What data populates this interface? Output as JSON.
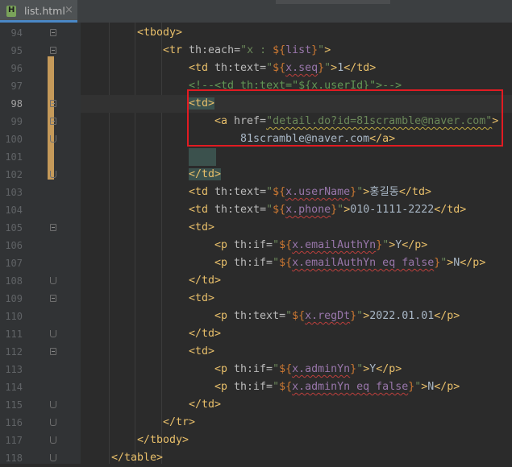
{
  "tab": {
    "file_name": "list.html",
    "close_glyph": "×",
    "file_icon": "html-file-icon"
  },
  "gutter": {
    "line_numbers": [
      "94",
      "95",
      "96",
      "97",
      "98",
      "99",
      "100",
      "101",
      "102",
      "103",
      "104",
      "105",
      "106",
      "107",
      "108",
      "109",
      "110",
      "111",
      "112",
      "113",
      "114",
      "115",
      "116",
      "117",
      "118"
    ],
    "current_line": "98"
  },
  "lines": [
    {
      "n": "94",
      "tokens": [
        [
          "tag",
          "<tbody>"
        ]
      ]
    },
    {
      "n": "95",
      "tokens": [
        [
          "tag",
          "<tr "
        ],
        [
          "attr",
          "th:each="
        ],
        [
          "str",
          "\"x : "
        ],
        [
          "expr",
          "${"
        ],
        [
          "var",
          "list"
        ],
        [
          "expr",
          "}"
        ],
        [
          "str",
          "\""
        ],
        [
          "tag",
          ">"
        ]
      ]
    },
    {
      "n": "96",
      "tokens": [
        [
          "tag",
          "<td "
        ],
        [
          "attr",
          "th:text="
        ],
        [
          "str",
          "\""
        ],
        [
          "expr",
          "${"
        ],
        [
          "var",
          "x.seq"
        ],
        [
          "expr",
          "}"
        ],
        [
          "str",
          "\""
        ],
        [
          "tag",
          ">"
        ],
        [
          "text",
          "1"
        ],
        [
          "tag",
          "</td>"
        ]
      ]
    },
    {
      "n": "97",
      "tokens": [
        [
          "comment",
          "<!--<td th:text=\"${x.userId}\">-->"
        ]
      ]
    },
    {
      "n": "98",
      "tokens": [
        [
          "tag",
          "<td>"
        ]
      ]
    },
    {
      "n": "99",
      "tokens": [
        [
          "tag",
          "<a "
        ],
        [
          "attr",
          "href="
        ],
        [
          "str",
          "\"detail.do?id=81scramble@naver.com\""
        ],
        [
          "tag",
          ">"
        ]
      ]
    },
    {
      "n": "100",
      "tokens": [
        [
          "text",
          "81scramble@naver.com"
        ],
        [
          "tag",
          "</a>"
        ]
      ]
    },
    {
      "n": "101",
      "tokens": []
    },
    {
      "n": "102",
      "tokens": [
        [
          "tag",
          "</td>"
        ]
      ]
    },
    {
      "n": "103",
      "tokens": [
        [
          "tag",
          "<td "
        ],
        [
          "attr",
          "th:text="
        ],
        [
          "str",
          "\""
        ],
        [
          "expr",
          "${"
        ],
        [
          "var",
          "x.userName"
        ],
        [
          "expr",
          "}"
        ],
        [
          "str",
          "\""
        ],
        [
          "tag",
          ">"
        ],
        [
          "text",
          "홍길동"
        ],
        [
          "tag",
          "</td>"
        ]
      ]
    },
    {
      "n": "104",
      "tokens": [
        [
          "tag",
          "<td "
        ],
        [
          "attr",
          "th:text="
        ],
        [
          "str",
          "\""
        ],
        [
          "expr",
          "${"
        ],
        [
          "var",
          "x.phone"
        ],
        [
          "expr",
          "}"
        ],
        [
          "str",
          "\""
        ],
        [
          "tag",
          ">"
        ],
        [
          "text",
          "010-1111-2222"
        ],
        [
          "tag",
          "</td>"
        ]
      ]
    },
    {
      "n": "105",
      "tokens": [
        [
          "tag",
          "<td>"
        ]
      ]
    },
    {
      "n": "106",
      "tokens": [
        [
          "tag",
          "<p "
        ],
        [
          "attr",
          "th:if="
        ],
        [
          "str",
          "\""
        ],
        [
          "expr",
          "${"
        ],
        [
          "var",
          "x.emailAuthYn"
        ],
        [
          "expr",
          "}"
        ],
        [
          "str",
          "\""
        ],
        [
          "tag",
          ">"
        ],
        [
          "text",
          "Y"
        ],
        [
          "tag",
          "</p>"
        ]
      ]
    },
    {
      "n": "107",
      "tokens": [
        [
          "tag",
          "<p "
        ],
        [
          "attr",
          "th:if="
        ],
        [
          "str",
          "\""
        ],
        [
          "expr",
          "${"
        ],
        [
          "var",
          "x.emailAuthYn eq false"
        ],
        [
          "expr",
          "}"
        ],
        [
          "str",
          "\""
        ],
        [
          "tag",
          ">"
        ],
        [
          "text",
          "N"
        ],
        [
          "tag",
          "</p>"
        ]
      ]
    },
    {
      "n": "108",
      "tokens": [
        [
          "tag",
          "</td>"
        ]
      ]
    },
    {
      "n": "109",
      "tokens": [
        [
          "tag",
          "<td>"
        ]
      ]
    },
    {
      "n": "110",
      "tokens": [
        [
          "tag",
          "<p "
        ],
        [
          "attr",
          "th:text="
        ],
        [
          "str",
          "\""
        ],
        [
          "expr",
          "${"
        ],
        [
          "var",
          "x.regDt"
        ],
        [
          "expr",
          "}"
        ],
        [
          "str",
          "\""
        ],
        [
          "tag",
          ">"
        ],
        [
          "text",
          "2022.01.01"
        ],
        [
          "tag",
          "</p>"
        ]
      ]
    },
    {
      "n": "111",
      "tokens": [
        [
          "tag",
          "</td>"
        ]
      ]
    },
    {
      "n": "112",
      "tokens": [
        [
          "tag",
          "<td>"
        ]
      ]
    },
    {
      "n": "113",
      "tokens": [
        [
          "tag",
          "<p "
        ],
        [
          "attr",
          "th:if="
        ],
        [
          "str",
          "\""
        ],
        [
          "expr",
          "${"
        ],
        [
          "var",
          "x.adminYn"
        ],
        [
          "expr",
          "}"
        ],
        [
          "str",
          "\""
        ],
        [
          "tag",
          ">"
        ],
        [
          "text",
          "Y"
        ],
        [
          "tag",
          "</p>"
        ]
      ]
    },
    {
      "n": "114",
      "tokens": [
        [
          "tag",
          "<p "
        ],
        [
          "attr",
          "th:if="
        ],
        [
          "str",
          "\""
        ],
        [
          "expr",
          "${"
        ],
        [
          "var",
          "x.adminYn eq false"
        ],
        [
          "expr",
          "}"
        ],
        [
          "str",
          "\""
        ],
        [
          "tag",
          ">"
        ],
        [
          "text",
          "N"
        ],
        [
          "tag",
          "</p>"
        ]
      ]
    },
    {
      "n": "115",
      "tokens": [
        [
          "tag",
          "</td>"
        ]
      ]
    },
    {
      "n": "116",
      "tokens": [
        [
          "tag",
          "</tr>"
        ]
      ]
    },
    {
      "n": "117",
      "tokens": [
        [
          "tag",
          "</tbody>"
        ]
      ]
    },
    {
      "n": "118",
      "tokens": [
        [
          "tag",
          "</table>"
        ]
      ]
    }
  ],
  "colors": {
    "background": "#2b2b2b",
    "gutter": "#313335",
    "tag": "#e8bf6a",
    "attribute": "#bababa",
    "string": "#6a8759",
    "expression": "#cc7832",
    "variable": "#9876aa",
    "comment": "#629755",
    "highlight_box": "#e21b22",
    "change_marker": "#c59a5a"
  }
}
